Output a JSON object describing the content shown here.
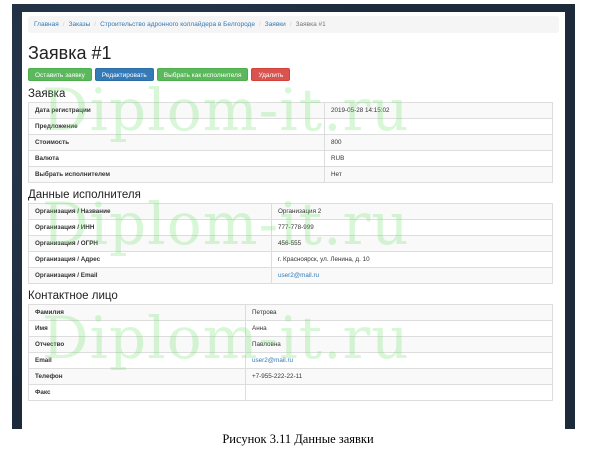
{
  "breadcrumb": [
    "Главная",
    "Заказы",
    "Строительство адронного коллайдера в Белгороде",
    "Заявки",
    "Заявка #1"
  ],
  "page_title": "Заявка #1",
  "actions": {
    "leave_request": "Оставить заявку",
    "edit": "Редактировать",
    "choose_executor": "Выбрать как исполнителя",
    "delete": "Удалить"
  },
  "request": {
    "title": "Заявка",
    "rows": [
      {
        "key": "Дата регистрации",
        "value": "2019-05-28 14:15:02"
      },
      {
        "key": "Предложение",
        "value": ""
      },
      {
        "key": "Стоимость",
        "value": "800"
      },
      {
        "key": "Валюта",
        "value": "RUB"
      },
      {
        "key": "Выбрать исполнителем",
        "value": "Нет"
      }
    ]
  },
  "executor": {
    "title": "Данные исполнителя",
    "rows": [
      {
        "key": "Организация / Название",
        "value": "Организация 2"
      },
      {
        "key": "Организация / ИНН",
        "value": "777-778-999"
      },
      {
        "key": "Организация / ОГРН",
        "value": "456-555"
      },
      {
        "key": "Организация / Адрес",
        "value": "г. Красноярск, ул. Ленина, д. 10"
      },
      {
        "key": "Организация / Email",
        "value": "user2@mail.ru"
      }
    ]
  },
  "contact": {
    "title": "Контактное лицо",
    "rows": [
      {
        "key": "Фамилия",
        "value": "Петрова"
      },
      {
        "key": "Имя",
        "value": "Анна"
      },
      {
        "key": "Отчество",
        "value": "Павловна"
      },
      {
        "key": "Email",
        "value": "user2@mail.ru"
      },
      {
        "key": "Телефон",
        "value": "+7-955-222-22-11"
      },
      {
        "key": "Факс",
        "value": ""
      }
    ]
  },
  "watermark": "Diplom-it.ru",
  "caption": "Рисунок 3.11 Данные заявки"
}
